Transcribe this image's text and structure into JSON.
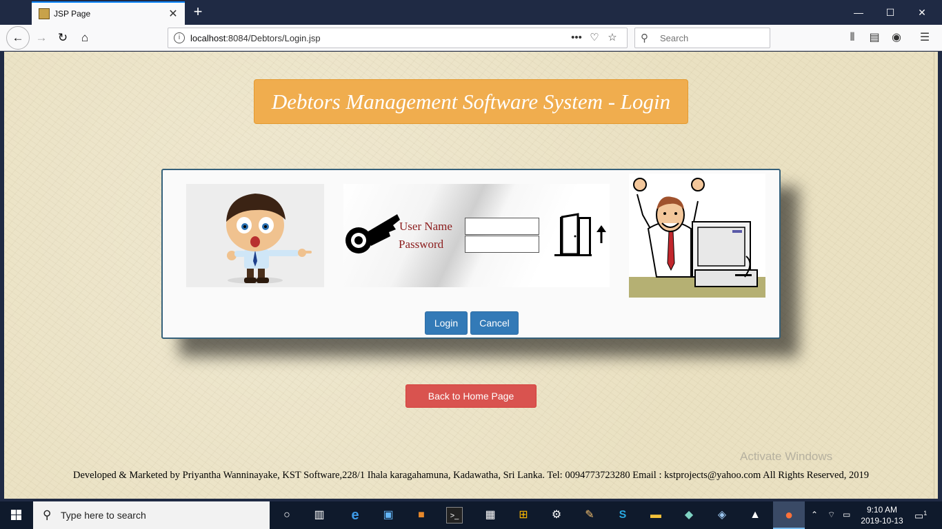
{
  "browser": {
    "tab_title": "JSP Page",
    "tab_close": "✕",
    "new_tab": "+",
    "url_host": "localhost",
    "url_rest": ":8084/Debtors/Login.jsp",
    "search_placeholder": "Search",
    "window_controls": {
      "minimize": "—",
      "maximize": "☐",
      "close": "✕"
    }
  },
  "page": {
    "heading": "Debtors Management Software System - Login",
    "form": {
      "username_label": "User Name",
      "password_label": "Password",
      "username_value": "",
      "password_value": ""
    },
    "buttons": {
      "login": "Login",
      "cancel": "Cancel",
      "back_home": "Back to Home Page"
    },
    "footer": "Developed & Marketed by Priyantha Wanninayake, KST Software,228/1 Ihala karagahamuna, Kadawatha, Sri Lanka. Tel: 0094773723280 Email : kstprojects@yahoo.com All Rights Reserved, 2019",
    "watermark": "Activate Windows"
  },
  "taskbar": {
    "search_text": "Type here to search",
    "time": "9:10 AM",
    "date": "2019-10-13",
    "notification_count": "1"
  },
  "colors": {
    "heading_bg": "#f0ad4e",
    "primary": "#337ab7",
    "danger": "#d9534f",
    "label": "#8b1c1c",
    "page_bg": "#eae1c2"
  }
}
